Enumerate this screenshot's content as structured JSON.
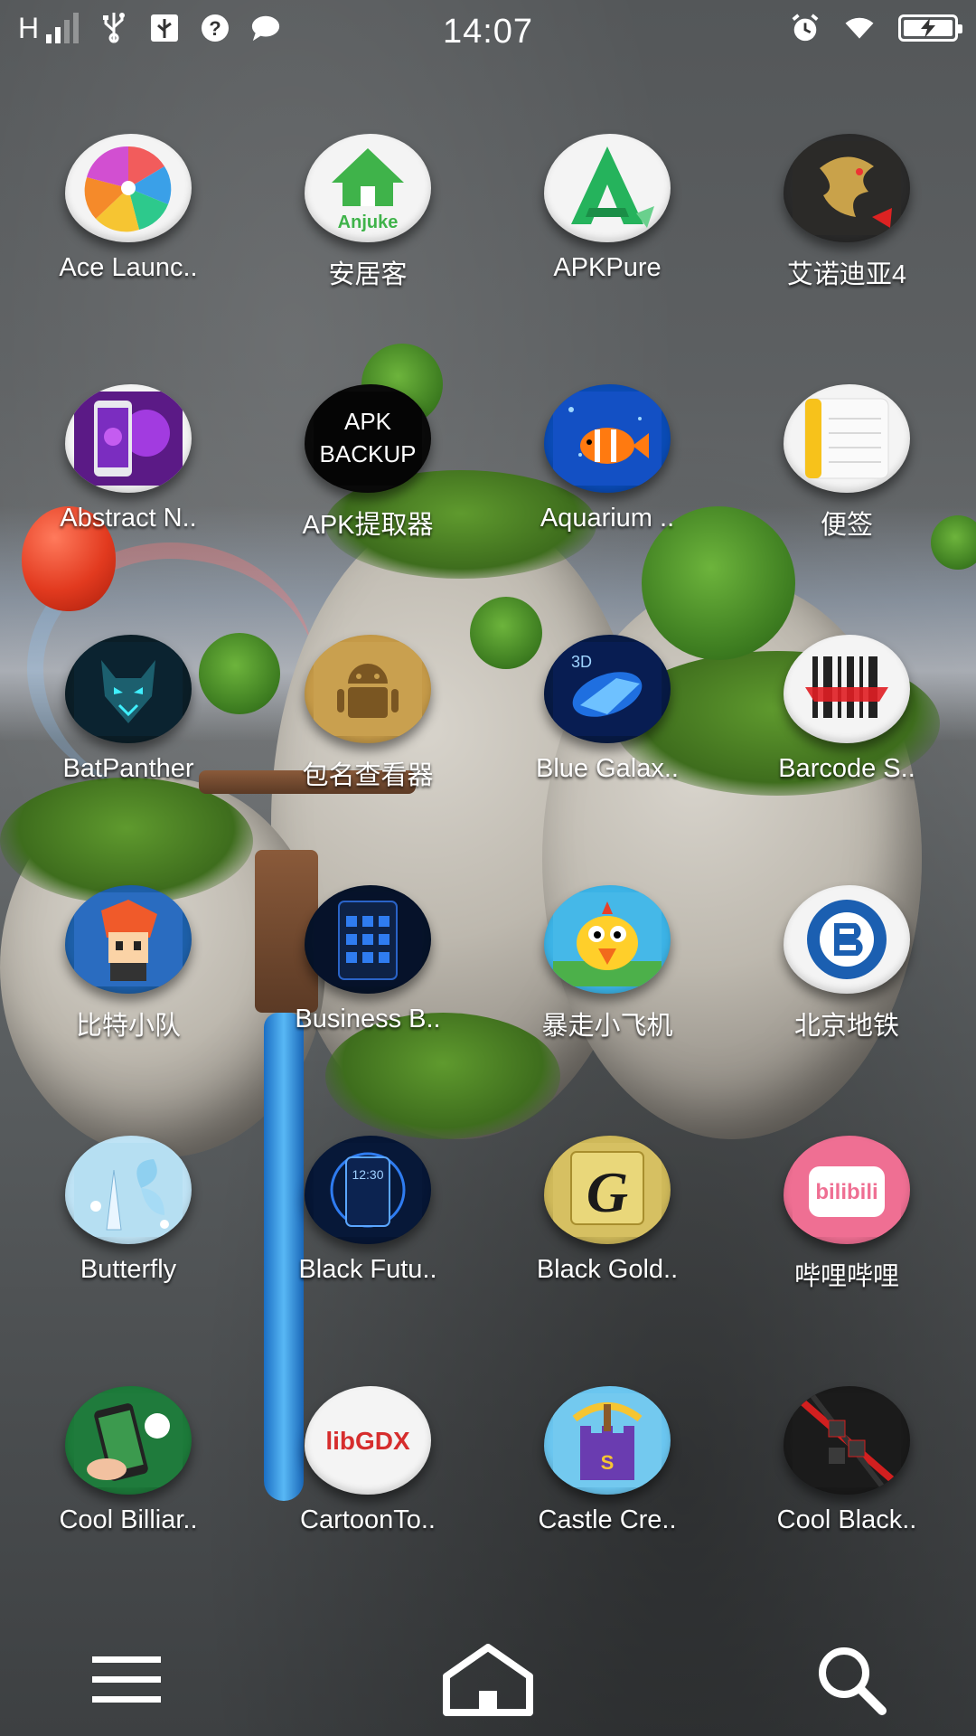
{
  "status_bar": {
    "network": "H",
    "time": "14:07"
  },
  "apps": [
    {
      "label": "Ace Launc..",
      "icon": "pinwheel-icon"
    },
    {
      "label": "安居客",
      "icon": "anjuke-house-icon",
      "icon_text": "Anjuke"
    },
    {
      "label": "APKPure",
      "icon": "apkpure-a-icon"
    },
    {
      "label": "艾诺迪亚4",
      "icon": "golden-dragon-icon"
    },
    {
      "label": "Abstract N..",
      "icon": "abstract-phone-theme-icon"
    },
    {
      "label": "APK提取器",
      "icon": "apk-backup-icon",
      "icon_text_1": "APK",
      "icon_text_2": "BACKUP"
    },
    {
      "label": "Aquarium ..",
      "icon": "clownfish-icon"
    },
    {
      "label": "便签",
      "icon": "notepad-icon"
    },
    {
      "label": "BatPanther",
      "icon": "cyber-panther-icon"
    },
    {
      "label": "包名查看器",
      "icon": "android-robot-icon"
    },
    {
      "label": "Blue Galax..",
      "icon": "blue-galaxy-3d-icon"
    },
    {
      "label": "Barcode S..",
      "icon": "barcode-scanner-icon"
    },
    {
      "label": "比特小队",
      "icon": "pixel-hero-icon"
    },
    {
      "label": "Business B..",
      "icon": "business-theme-icon"
    },
    {
      "label": "暴走小飞机",
      "icon": "angry-bird-icon"
    },
    {
      "label": "北京地铁",
      "icon": "beijing-subway-icon"
    },
    {
      "label": "Butterfly",
      "icon": "butterfly-theme-icon"
    },
    {
      "label": "Black Futu..",
      "icon": "black-future-theme-icon"
    },
    {
      "label": "Black Gold..",
      "icon": "black-gold-g-icon",
      "icon_text": "G"
    },
    {
      "label": "哔哩哔哩",
      "icon": "bilibili-icon",
      "icon_text": "bilibili"
    },
    {
      "label": "Cool Billiar..",
      "icon": "billiard-phone-icon"
    },
    {
      "label": "CartoonTo..",
      "icon": "libgdx-icon",
      "icon_text": "libGDX"
    },
    {
      "label": "Castle Cre..",
      "icon": "castle-crush-icon"
    },
    {
      "label": "Cool Black..",
      "icon": "cool-black-theme-icon"
    }
  ],
  "dock": {
    "left": "menu-icon",
    "center": "home-icon",
    "right": "search-icon"
  },
  "colors": {
    "text": "#ffffff",
    "bilibili_pink": "#ef6f93",
    "subway_blue": "#1b5fb1",
    "apkpure_green": "#25b35c"
  }
}
